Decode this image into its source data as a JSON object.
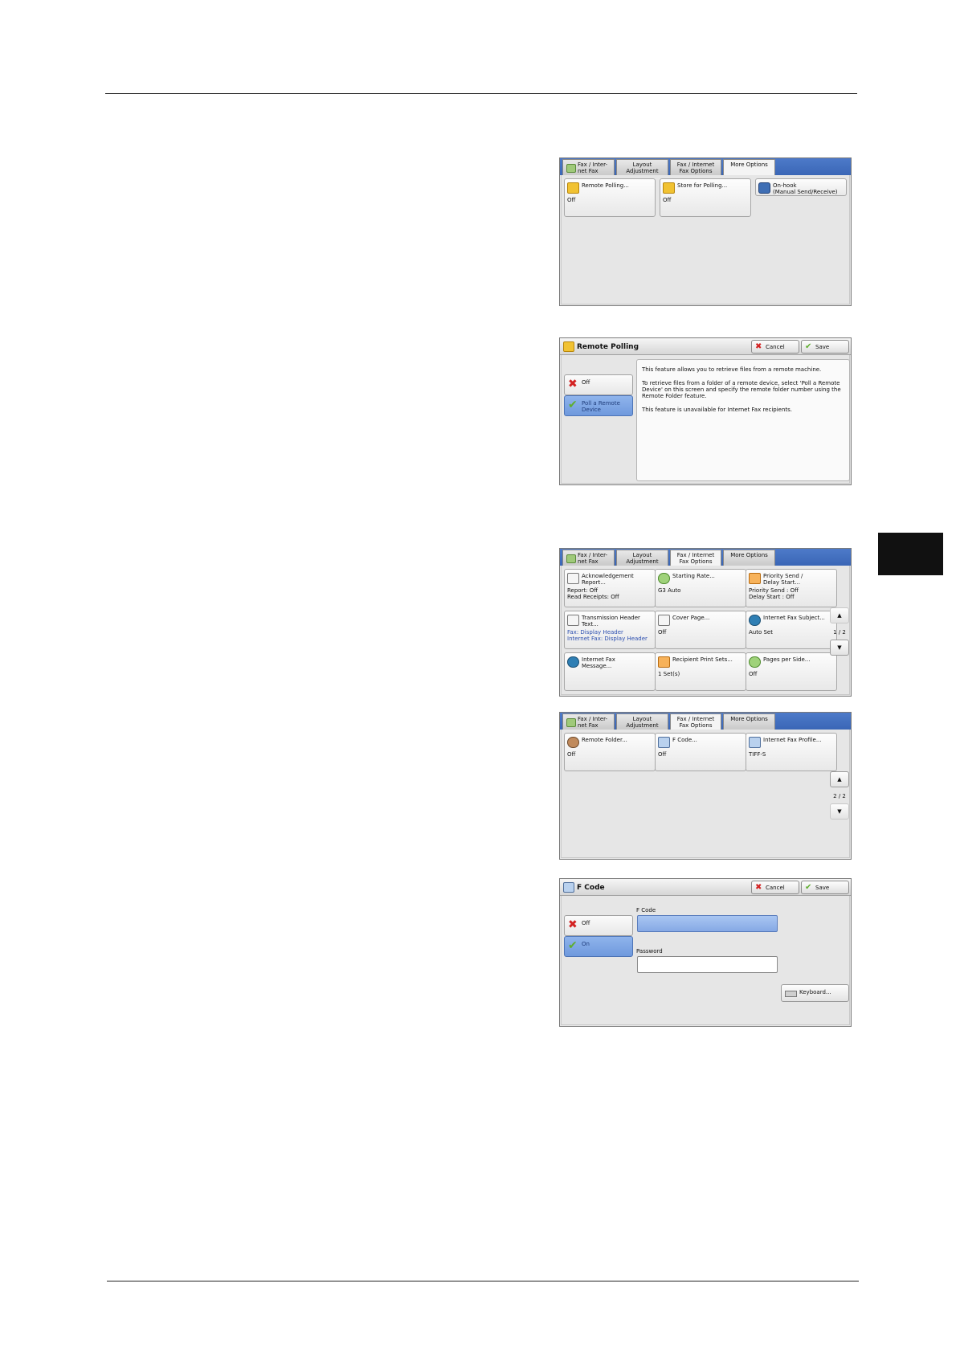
{
  "tabs": [
    "Fax / Inter-\nnet Fax",
    "Layout\nAdjustment",
    "Fax / Internet\nFax Options",
    "More Options"
  ],
  "panel_more_options": {
    "buttons": [
      {
        "label": "Remote Polling...",
        "value": "Off"
      },
      {
        "label": "Store for Polling...",
        "value": "Off"
      },
      {
        "label": "On-hook\n(Manual Send/Receive)",
        "value": ""
      }
    ]
  },
  "panel_remote_polling": {
    "title": "Remote Polling",
    "cancel": "Cancel",
    "save": "Save",
    "options": [
      "Off",
      "Poll a Remote\nDevice"
    ],
    "info": [
      "This feature allows you to retrieve files from a remote machine.",
      "To retrieve files from a folder of a remote device, select 'Poll a Remote Device' on this screen and specify the remote folder number using the Remote Folder feature.",
      "This feature is unavailable for Internet Fax recipients."
    ]
  },
  "panel_fax_options_p1": {
    "page": "1 / 2",
    "up": "▲",
    "down": "▼",
    "buttons": [
      {
        "label": "Acknowledgement\nReport...",
        "value": "Report: Off\nRead Receipts: Off"
      },
      {
        "label": "Starting Rate...",
        "value": "G3 Auto"
      },
      {
        "label": "Priority Send /\nDelay Start...",
        "value": "Priority Send : Off\nDelay Start : Off"
      },
      {
        "label": "Transmission Header\nText...",
        "value": "Fax: Display Header\nInternet Fax: Display Header"
      },
      {
        "label": "Cover Page...",
        "value": "Off"
      },
      {
        "label": "Internet Fax Subject...",
        "value": "Auto Set"
      },
      {
        "label": "Internet Fax\nMessage...",
        "value": ""
      },
      {
        "label": "Recipient Print Sets...",
        "value": "1 Set(s)"
      },
      {
        "label": "Pages per Side...",
        "value": "Off"
      }
    ]
  },
  "panel_fax_options_p2": {
    "page": "2 / 2",
    "up": "▲",
    "down": "▼",
    "buttons": [
      {
        "label": "Remote Folder...",
        "value": "Off"
      },
      {
        "label": "F Code...",
        "value": "Off"
      },
      {
        "label": "Internet Fax Profile...",
        "value": "TIFF-S"
      }
    ]
  },
  "panel_fcode": {
    "title": "F Code",
    "cancel": "Cancel",
    "save": "Save",
    "options": [
      "Off",
      "On"
    ],
    "fcode_label": "F Code",
    "fcode_value": "",
    "password_label": "Password",
    "password_value": "",
    "keyboard": "Keyboard..."
  },
  "colors": {
    "tabbar": "#3a66b6",
    "selected": "#7fa6e4",
    "panel_bg": "#e6e6e6"
  }
}
